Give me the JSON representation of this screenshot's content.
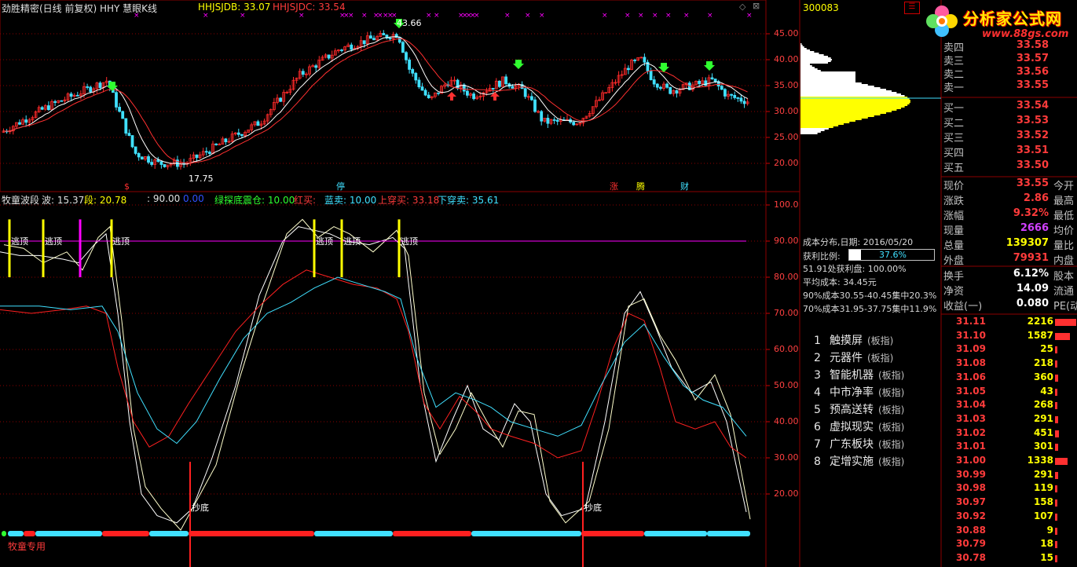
{
  "header": {
    "title": "劲胜精密(日线 前复权) HHY 慧眼K线",
    "ind1": "HHJSJDB: 33.07",
    "ind2": "HHJSJDC: 33.54"
  },
  "main_chart": {
    "y_ticks": [
      "45.00",
      "40.00",
      "35.00",
      "30.00",
      "25.00",
      "20.00"
    ],
    "high_label": "43.66",
    "low_label": "17.75",
    "markers": [
      "$",
      "停",
      "涨",
      "腾",
      "财"
    ]
  },
  "sub_header": {
    "name": "牧童波段",
    "wave": "波: 15.37",
    "duan": "段: 20.78",
    "v90": ": 90.00",
    "v0": "0.00",
    "green": "绿探底震仓: 10.00",
    "red_buy": "红买: ",
    "blue_sell": "蓝卖: 10.00",
    "up_cross": "上穿买: 33.18",
    "down_cross": "下穿卖: 35.61"
  },
  "sub_chart": {
    "y_ticks": [
      "100.0",
      "90.00",
      "80.00",
      "70.00",
      "60.00",
      "50.00",
      "40.00",
      "30.00",
      "20.00"
    ],
    "top_labels": [
      "逃顶",
      "逃顶",
      "逃顶",
      "逃顶",
      "逃顶",
      "逃顶"
    ],
    "bottom_labels": [
      "抄底",
      "抄底"
    ],
    "footer": "牧童专用"
  },
  "stock_code": "300083",
  "logo": {
    "name": "分析家公式网",
    "url": "www.88gs.com"
  },
  "order_book": {
    "sells": [
      {
        "label": "卖四",
        "price": "33.58"
      },
      {
        "label": "卖三",
        "price": "33.57"
      },
      {
        "label": "卖二",
        "price": "33.56"
      },
      {
        "label": "卖一",
        "price": "33.55"
      }
    ],
    "buys": [
      {
        "label": "买一",
        "price": "33.54"
      },
      {
        "label": "买二",
        "price": "33.53"
      },
      {
        "label": "买三",
        "price": "33.52"
      },
      {
        "label": "买四",
        "price": "33.51"
      },
      {
        "label": "买五",
        "price": "33.50"
      }
    ]
  },
  "quote": [
    {
      "label": "现价",
      "value": "33.55",
      "color": "#ff3b3b",
      "label2": "今开"
    },
    {
      "label": "涨跌",
      "value": "2.86",
      "color": "#ff3b3b",
      "label2": "最高"
    },
    {
      "label": "涨幅",
      "value": "9.32%",
      "color": "#ff3b3b",
      "label2": "最低"
    },
    {
      "label": "现量",
      "value": "2666",
      "color": "#d040ff",
      "label2": "均价"
    },
    {
      "label": "总量",
      "value": "139307",
      "color": "#ffff00",
      "label2": "量比"
    },
    {
      "label": "外盘",
      "value": "79931",
      "color": "#ff3b3b",
      "label2": "内盘"
    }
  ],
  "quote2": [
    {
      "label": "换手",
      "value": "6.12%",
      "label2": "股本"
    },
    {
      "label": "净资",
      "value": "14.09",
      "label2": "流通"
    },
    {
      "label": "收益(一)",
      "value": "0.080",
      "label2": "PE(动)"
    }
  ],
  "cost": {
    "date": "成本分布,日期: 2016/05/20",
    "profit_label": "获利比例:",
    "profit_value": "37.6%",
    "profit_fraction": 0.376,
    "line1": "51.91处获利盘: 100.00%",
    "line2": "平均成本: 34.45元",
    "line3": "90%成本30.55-40.45集中20.3%",
    "line4": "70%成本31.95-37.75集中11.9%"
  },
  "boards": [
    {
      "n": "1",
      "name": "触摸屏",
      "tag": "(板指)"
    },
    {
      "n": "2",
      "name": "元器件",
      "tag": "(板指)"
    },
    {
      "n": "3",
      "name": "智能机器",
      "tag": "(板指)"
    },
    {
      "n": "4",
      "name": "中市净率",
      "tag": "(板指)"
    },
    {
      "n": "5",
      "name": "预高送转",
      "tag": "(板指)"
    },
    {
      "n": "6",
      "name": "虚拟现实",
      "tag": "(板指)"
    },
    {
      "n": "7",
      "name": "广东板块",
      "tag": "(板指)"
    },
    {
      "n": "8",
      "name": "定增实施",
      "tag": "(板指)"
    }
  ],
  "volume_ladder": [
    {
      "price": "31.11",
      "vol": "2216",
      "frac": 1.0
    },
    {
      "price": "31.10",
      "vol": "1587",
      "frac": 0.72
    },
    {
      "price": "31.09",
      "vol": "25",
      "frac": 0.02
    },
    {
      "price": "31.08",
      "vol": "218",
      "frac": 0.1
    },
    {
      "price": "31.06",
      "vol": "360",
      "frac": 0.16
    },
    {
      "price": "31.05",
      "vol": "43",
      "frac": 0.03
    },
    {
      "price": "31.04",
      "vol": "268",
      "frac": 0.12
    },
    {
      "price": "31.03",
      "vol": "291",
      "frac": 0.13
    },
    {
      "price": "31.02",
      "vol": "451",
      "frac": 0.2
    },
    {
      "price": "31.01",
      "vol": "301",
      "frac": 0.14
    },
    {
      "price": "31.00",
      "vol": "1338",
      "frac": 0.6
    },
    {
      "price": "30.99",
      "vol": "291",
      "frac": 0.13
    },
    {
      "price": "30.98",
      "vol": "119",
      "frac": 0.05
    },
    {
      "price": "30.97",
      "vol": "158",
      "frac": 0.07
    },
    {
      "price": "30.92",
      "vol": "107",
      "frac": 0.05
    },
    {
      "price": "30.88",
      "vol": "9",
      "frac": 0.01
    },
    {
      "price": "30.79",
      "vol": "18",
      "frac": 0.01
    },
    {
      "price": "30.78",
      "vol": "15",
      "frac": 0.01
    }
  ],
  "colors": {
    "up": "#ff2a2a",
    "down": "#40e0ff",
    "ma_fast": "#ffffff",
    "ma_slow": "#ff3030",
    "grid": "#8b0000",
    "yellow": "#ffff00",
    "magenta": "#ff00ff",
    "cyan": "#40e0ff"
  }
}
